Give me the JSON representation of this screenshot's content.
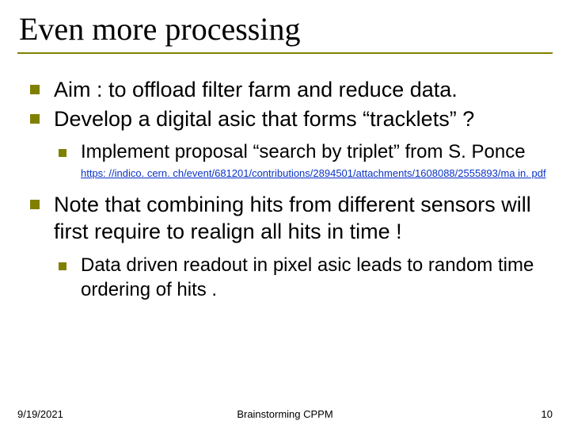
{
  "title": "Even more processing",
  "bullets": {
    "b1": "Aim : to offload filter farm and reduce data.",
    "b2": "Develop a digital asic that forms “tracklets” ?",
    "b2_sub1": "Implement proposal “search by triplet” from S. Ponce",
    "b2_sub1_link": "https: //indico. cern. ch/event/681201/contributions/2894501/attachments/1608088/2555893/ma in. pdf",
    "b3": "Note that combining hits from different sensors will first require to realign all hits in time !",
    "b3_sub1": "Data driven readout in pixel asic leads to random time ordering of hits ."
  },
  "footer": {
    "date": "9/19/2021",
    "center": "Brainstorming CPPM",
    "page_number": "10"
  }
}
